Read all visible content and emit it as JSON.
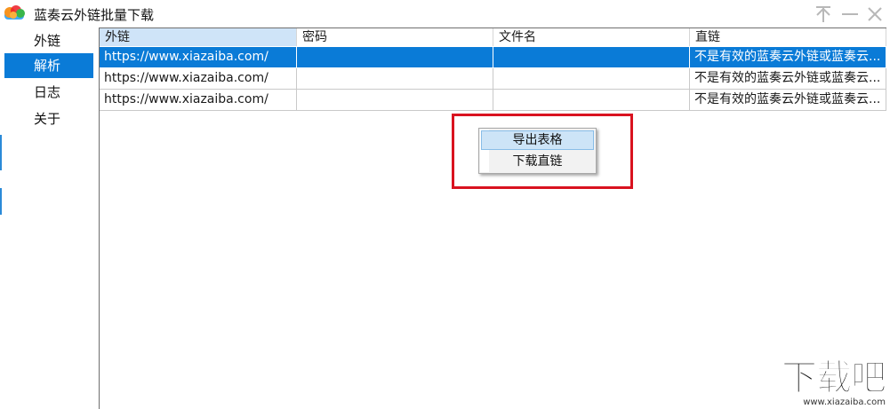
{
  "window": {
    "title": "蓝奏云外链批量下载",
    "controls": {
      "pin": "pin-icon",
      "minimize": "minimize-icon",
      "close": "close-icon"
    },
    "app_icon": "cloud-icon"
  },
  "sidebar": {
    "items": [
      {
        "label": "外链",
        "active": false
      },
      {
        "label": "解析",
        "active": true
      },
      {
        "label": "日志",
        "active": false
      },
      {
        "label": "关于",
        "active": false
      }
    ]
  },
  "grid": {
    "columns": [
      "外链",
      "密码",
      "文件名",
      "直链"
    ],
    "rows": [
      {
        "cells": [
          "https://www.xiazaiba.com/",
          "",
          "",
          "不是有效的蓝奏云外链或蓝奏云..."
        ],
        "selected": true
      },
      {
        "cells": [
          "https://www.xiazaiba.com/",
          "",
          "",
          "不是有效的蓝奏云外链或蓝奏云..."
        ],
        "selected": false
      },
      {
        "cells": [
          "https://www.xiazaiba.com/",
          "",
          "",
          "不是有效的蓝奏云外链或蓝奏云..."
        ],
        "selected": false
      }
    ]
  },
  "context_menu": {
    "items": [
      "导出表格",
      "下载直链"
    ]
  },
  "watermark": {
    "main": "下载吧",
    "sub": "www.xiazaiba.com"
  },
  "colors": {
    "accent": "#0a7bd7",
    "highlight_box": "#d9121f",
    "menu_hover": "#cde4f7"
  }
}
